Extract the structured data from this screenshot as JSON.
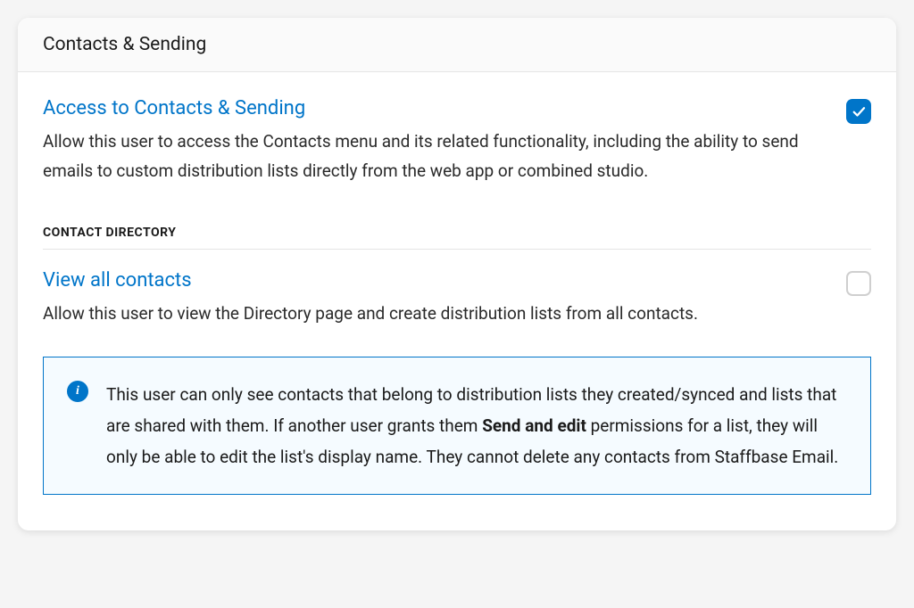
{
  "header": {
    "title": "Contacts & Sending"
  },
  "settings": {
    "access": {
      "title": "Access to Contacts & Sending",
      "description": "Allow this user to access the Contacts menu and its related functionality, including the ability to send emails to custom distribution lists directly from the web app or combined studio.",
      "checked": true
    },
    "directory_label": "CONTACT DIRECTORY",
    "view_all": {
      "title": "View all contacts",
      "description": "Allow this user to view the Directory page and create distribution lists from all contacts.",
      "checked": false
    }
  },
  "info": {
    "text_before": "This user can only see contacts that belong to distribution lists they created/synced and lists that are shared with them. If another user grants them ",
    "bold": "Send and edit",
    "text_after": " permissions for a list, they will only be able to edit the list's display name. They cannot delete any contacts from Staffbase Email."
  }
}
